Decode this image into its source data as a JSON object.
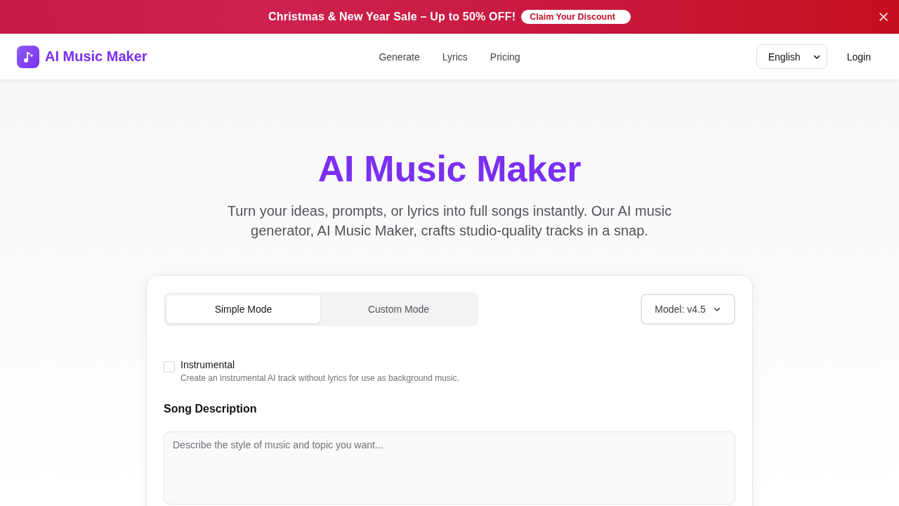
{
  "banner": {
    "message": "Christmas & New Year Sale – Up to 50% OFF!",
    "cta": "Claim Your Discount"
  },
  "nav": {
    "brand": "AI Music Maker",
    "links": [
      "Generate",
      "Lyrics",
      "Pricing"
    ],
    "language": "English",
    "login": "Login"
  },
  "hero": {
    "title": "AI Music Maker",
    "subtitle": "Turn your ideas, prompts, or lyrics into full songs instantly. Our AI music generator, AI Music Maker, crafts studio-quality tracks in a snap."
  },
  "form": {
    "modes": [
      {
        "label": "Simple Mode",
        "selected": true
      },
      {
        "label": "Custom Mode",
        "selected": false
      }
    ],
    "model": "Model: v4.5",
    "instrumental": {
      "label": "Instrumental",
      "description": "Create an instrumental AI track without lyrics for use as background music.",
      "checked": false
    },
    "song_description": {
      "label": "Song Description",
      "placeholder": "Describe the style of music and topic you want..."
    }
  }
}
